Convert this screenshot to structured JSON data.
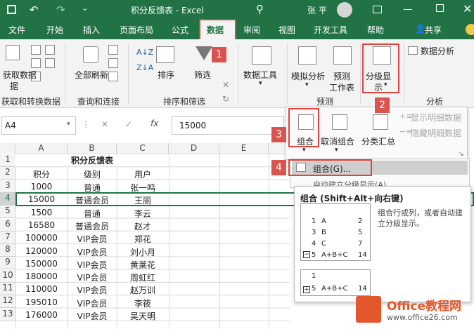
{
  "window": {
    "title": "积分反馈表 - Excel",
    "user": "张 平"
  },
  "tabs": [
    "文件",
    "开始",
    "插入",
    "页面布局",
    "公式",
    "数据",
    "审阅",
    "视图",
    "开发工具",
    "帮助"
  ],
  "share_label": "共享",
  "ribbon": {
    "get_data": "获取数据",
    "get_data_2": "据",
    "refresh_all": "全部刷新",
    "sort": "排序",
    "filter": "筛选",
    "data_tools": "数据工具",
    "what_if": "模拟分析",
    "forecast": "预测",
    "forecast_2": "工作表",
    "outline": "分级显",
    "outline_2": "示",
    "data_analysis": "数据分析",
    "group_get": "获取和转换数据",
    "group_query": "查询和连接",
    "group_sort": "排序和筛选",
    "group_forecast": "预测",
    "group_analysis": "分析"
  },
  "outline_panel": {
    "group": "组合",
    "ungroup": "取消组合",
    "subtotal": "分类汇总",
    "show_detail": "显示明细数据",
    "hide_detail": "隐藏明细数据"
  },
  "dropdown": {
    "group_item": "组合(G)...",
    "auto_outline": "自动建立分级显示(A)"
  },
  "tooltip": {
    "title": "组合 (Shift+Alt+向右键)",
    "desc": "组合行或列，或者自动建立分级显示。",
    "table1": [
      [
        "1",
        "A",
        "2"
      ],
      [
        "3",
        "B",
        "5"
      ],
      [
        "4",
        "C",
        "7"
      ],
      [
        "5",
        "A+B+C",
        "14"
      ]
    ],
    "table2": [
      [
        "1",
        "",
        ""
      ],
      [
        "5",
        "A+B+C",
        "14"
      ]
    ]
  },
  "formula_bar": {
    "name_box": "A4",
    "value": "15000"
  },
  "columns": [
    "A",
    "B",
    "C",
    "D",
    "E"
  ],
  "sheet": {
    "title": "积分反馈表",
    "header": [
      "积分",
      "级别",
      "用户"
    ],
    "rows": [
      [
        "1000",
        "普通",
        "张一鸣"
      ],
      [
        "15000",
        "普通会员",
        "王丽"
      ],
      [
        "1500",
        "普通",
        "李云"
      ],
      [
        "16580",
        "普通会员",
        "赵才"
      ],
      [
        "100000",
        "VIP会员",
        "郑花"
      ],
      [
        "120000",
        "VIP会员",
        "刘小月"
      ],
      [
        "150000",
        "VIP会员",
        "黄莱花"
      ],
      [
        "180000",
        "VIP会员",
        "周虹红"
      ],
      [
        "110000",
        "VIP会员",
        "赵万训"
      ],
      [
        "195010",
        "VIP会员",
        "李筱"
      ],
      [
        "176000",
        "VIP会员",
        "吴天明"
      ]
    ],
    "row_numbers": [
      "1",
      "2",
      "3",
      "4",
      "5",
      "6",
      "7",
      "8",
      "9",
      "10",
      "11",
      "12",
      "13"
    ]
  },
  "badges": [
    "1",
    "2",
    "3",
    "4"
  ],
  "watermark": {
    "brand": "Office教程网",
    "url": "www.office26.com"
  }
}
